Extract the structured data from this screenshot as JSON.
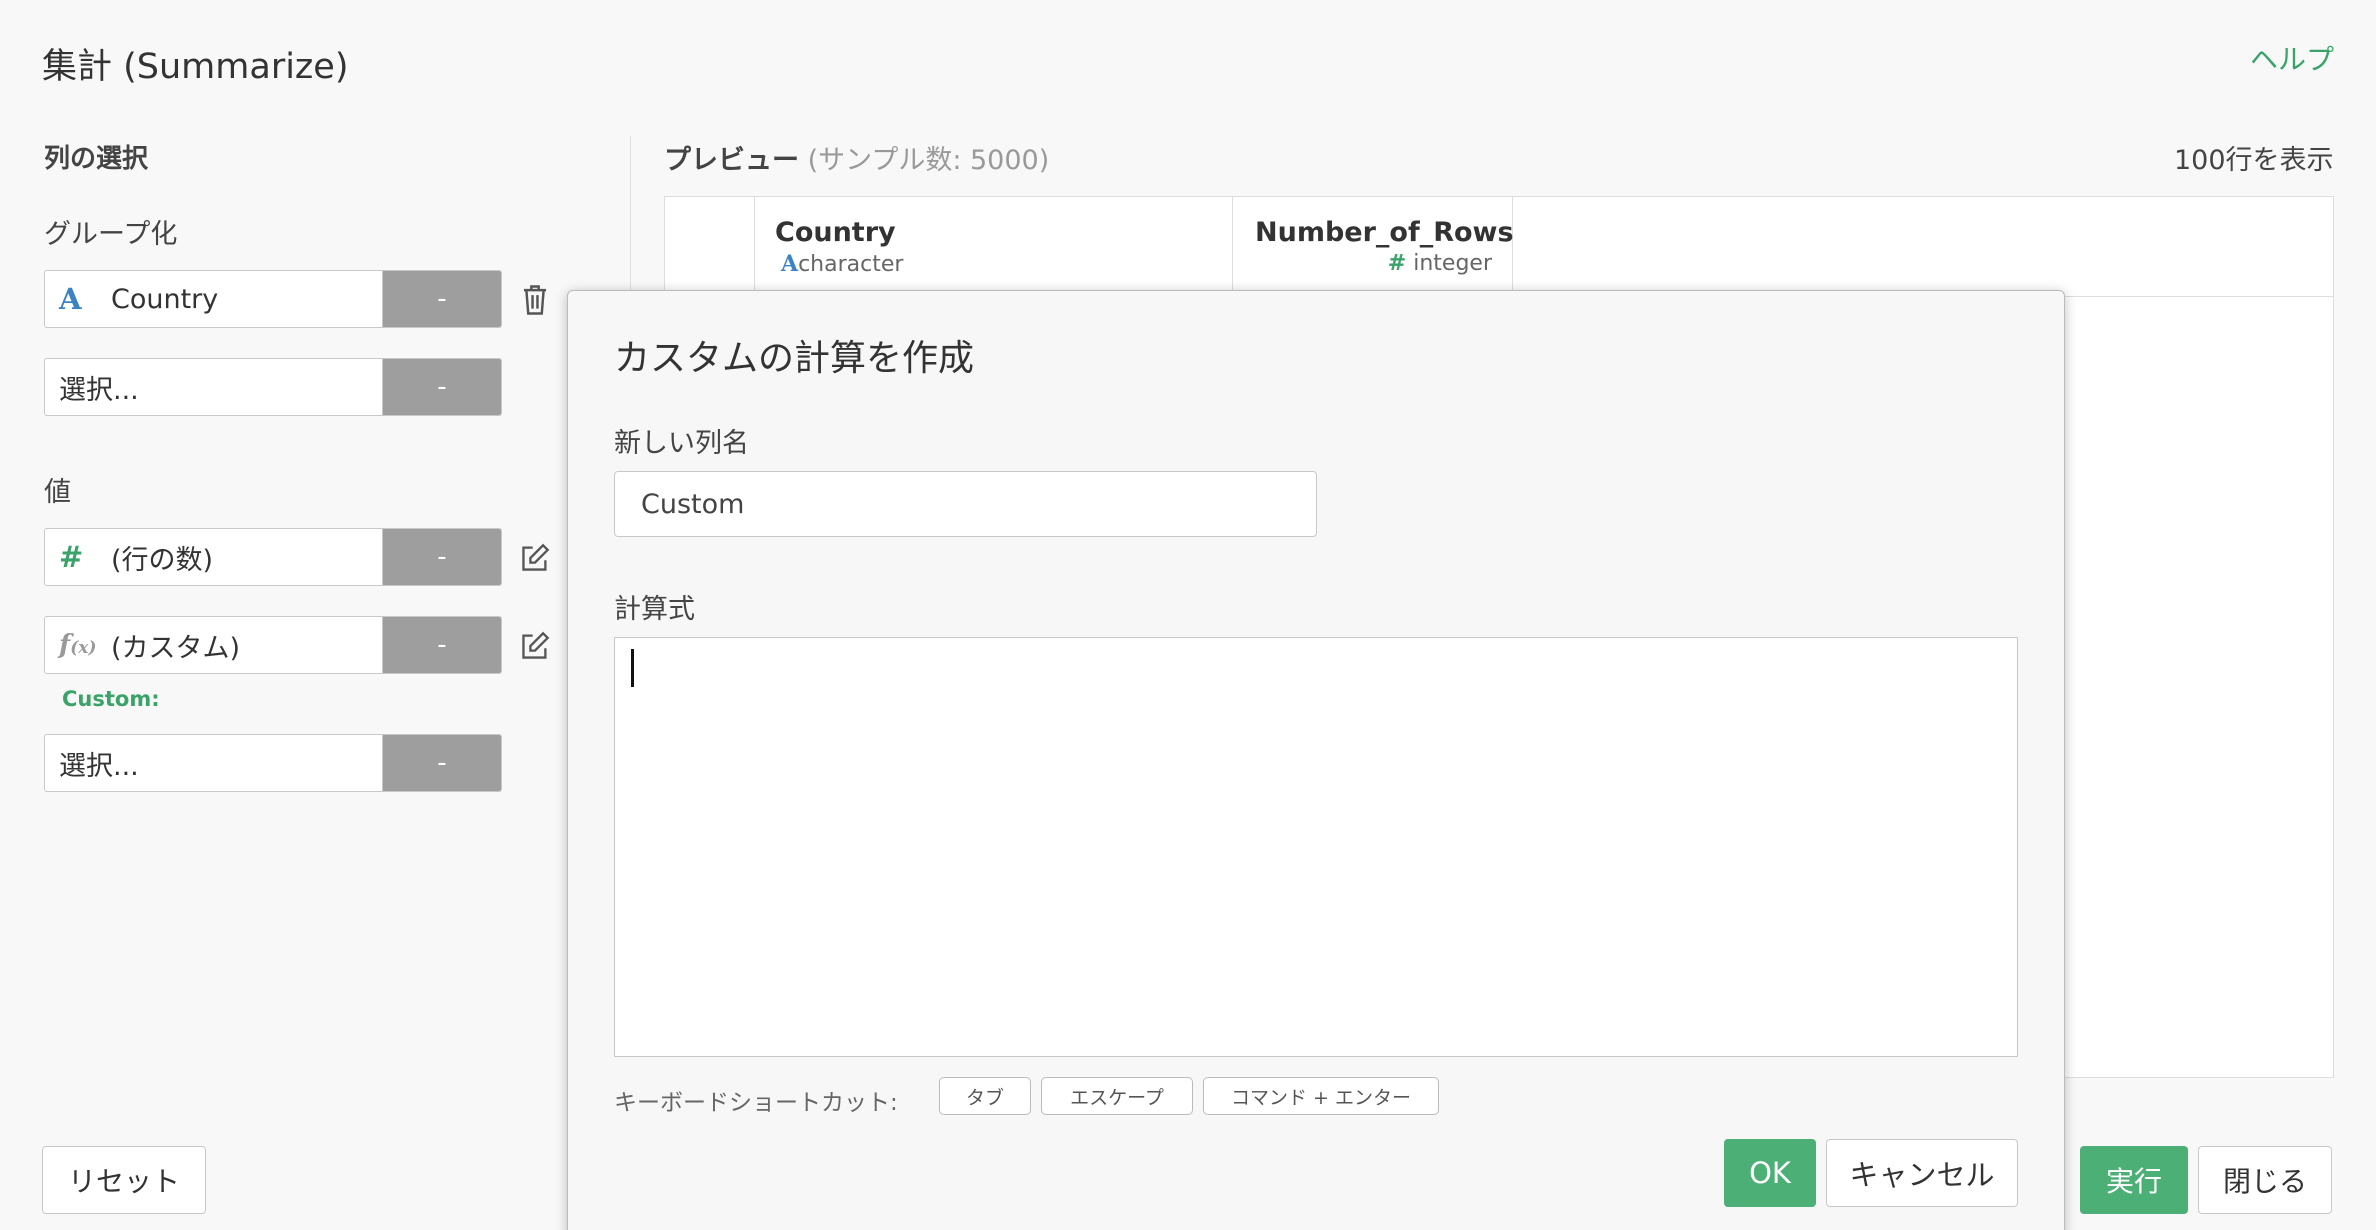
{
  "header": {
    "title": "集計 (Summarize)",
    "help": "ヘルプ"
  },
  "left_panel": {
    "column_select_title": "列の選択",
    "group_title": "グループ化",
    "group_items": [
      {
        "icon": "A",
        "label": "Country",
        "button": "-"
      },
      {
        "label": "選択...",
        "button": "-"
      }
    ],
    "value_title": "値",
    "value_items": [
      {
        "icon": "#",
        "label": "(行の数)",
        "button": "-"
      },
      {
        "icon": "f",
        "icon_sub": "(x)",
        "label": "(カスタム)",
        "button": "-"
      },
      {
        "label": "選択...",
        "button": "-"
      }
    ],
    "custom_label": "Custom:",
    "reset": "リセット"
  },
  "preview": {
    "title": "プレビュー",
    "sample": "(サンプル数: 5000)",
    "rows_display": "100行を表示",
    "columns": [
      {
        "name": "Country",
        "type_icon": "A",
        "type": "character"
      },
      {
        "name": "Number_of_Rows",
        "type_icon": "#",
        "type": "integer"
      }
    ]
  },
  "footer": {
    "run": "実行",
    "close": "閉じる"
  },
  "dialog": {
    "title": "カスタムの計算を作成",
    "column_name_label": "新しい列名",
    "column_name_value": "Custom",
    "formula_label": "計算式",
    "formula_value": "",
    "shortcut_label": "キーボードショートカット:",
    "shortcuts": [
      "タブ",
      "エスケープ",
      "コマンド + エンター"
    ],
    "ok": "OK",
    "cancel": "キャンセル"
  },
  "colors": {
    "accent_green": "#4caf76",
    "link_green": "#3aa36a",
    "type_blue": "#3b82c4",
    "button_gray": "#9e9e9e"
  }
}
